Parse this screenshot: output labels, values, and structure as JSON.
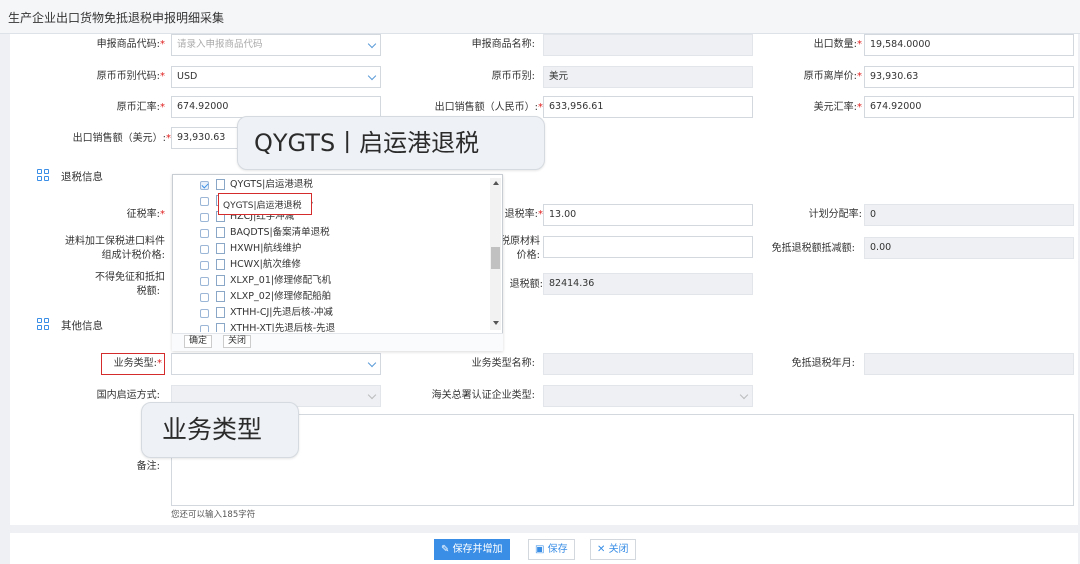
{
  "page": {
    "title": "生产企业出口货物免抵退税申报明细采集"
  },
  "fields": {
    "sbspdm": {
      "label": "申报商品代码:",
      "placeholder": "请录入申报商品代码"
    },
    "sbspmc": {
      "label": "申报商品名称:",
      "value": ""
    },
    "cksl": {
      "label": "出口数量:",
      "value": "19,584.0000"
    },
    "ybbbdm": {
      "label": "原币币别代码:",
      "value": "USD"
    },
    "ybbb": {
      "label": "原币币别:",
      "value": "美元"
    },
    "ybla": {
      "label": "原币离岸价:",
      "value": "93,930.63"
    },
    "ybhl": {
      "label": "原币汇率:",
      "value": "674.92000"
    },
    "ckxse_rmb": {
      "label": "出口销售额（人民币）:",
      "value": "633,956.61"
    },
    "myhl": {
      "label": "美元汇率:",
      "value": "674.92000"
    },
    "ckxse_usd": {
      "label": "出口销售额（美元）:",
      "value": "93,930.63"
    },
    "zsl": {
      "label": "征税率:"
    },
    "tsl": {
      "label": "退税率:",
      "value": "13.00"
    },
    "jhfpl": {
      "label": "计划分配率:",
      "value": "0"
    },
    "jlzgjj": {
      "label1": "进料加工保税进口料件",
      "label2": "组成计税价格:"
    },
    "bsycl": {
      "label1": "保税原材料",
      "label2": "价格:"
    },
    "mdtsejse": {
      "label": "免抵退税额抵减额:",
      "value": "0.00"
    },
    "bdmzdk": {
      "label1": "不得免征和抵扣",
      "label2": "税额:"
    },
    "tse": {
      "label": "退税额:",
      "value": "82414.36"
    },
    "ywlx": {
      "label": "业务类型:"
    },
    "ywlxmc": {
      "label": "业务类型名称:"
    },
    "mdtsny": {
      "label": "免抵退税年月:"
    },
    "gnqyfs": {
      "label": "国内启运方式:"
    },
    "hgzsrzqylx": {
      "label": "海关总署认证企业类型:"
    },
    "bz": {
      "label": "备注:",
      "hint": "您还可以输入185字符"
    }
  },
  "sections": {
    "tsxx": "退税信息",
    "qtxx": "其他信息"
  },
  "dropdown": {
    "items": [
      {
        "label": "QYGTS|启运港退税",
        "checked": true
      },
      {
        "label": "QYGTS|启运港退税",
        "checked": false
      },
      {
        "label": "HZCJ|红字冲减",
        "checked": false
      },
      {
        "label": "BAQDTS|备案清单退税",
        "checked": false
      },
      {
        "label": "HXWH|航线维护",
        "checked": false
      },
      {
        "label": "HCWX|航次维修",
        "checked": false
      },
      {
        "label": "XLXP_01|修理修配飞机",
        "checked": false
      },
      {
        "label": "XLXP_02|修理修配船舶",
        "checked": false
      },
      {
        "label": "XTHH-CJ|先退后核-冲减",
        "checked": false
      },
      {
        "label": "XTHH-XT|先退后核-先退",
        "checked": false
      }
    ],
    "confirm": "确定",
    "close": "关闭"
  },
  "callouts": {
    "top": "QYGTS丨启运港退税",
    "bottom": "业务类型"
  },
  "buttons": {
    "save_add": "保存并增加",
    "save": "保存",
    "close": "关闭"
  },
  "colors": {
    "accent": "#3a8ee6",
    "required": "#e02020",
    "highlight_box": "#d42c2c"
  }
}
